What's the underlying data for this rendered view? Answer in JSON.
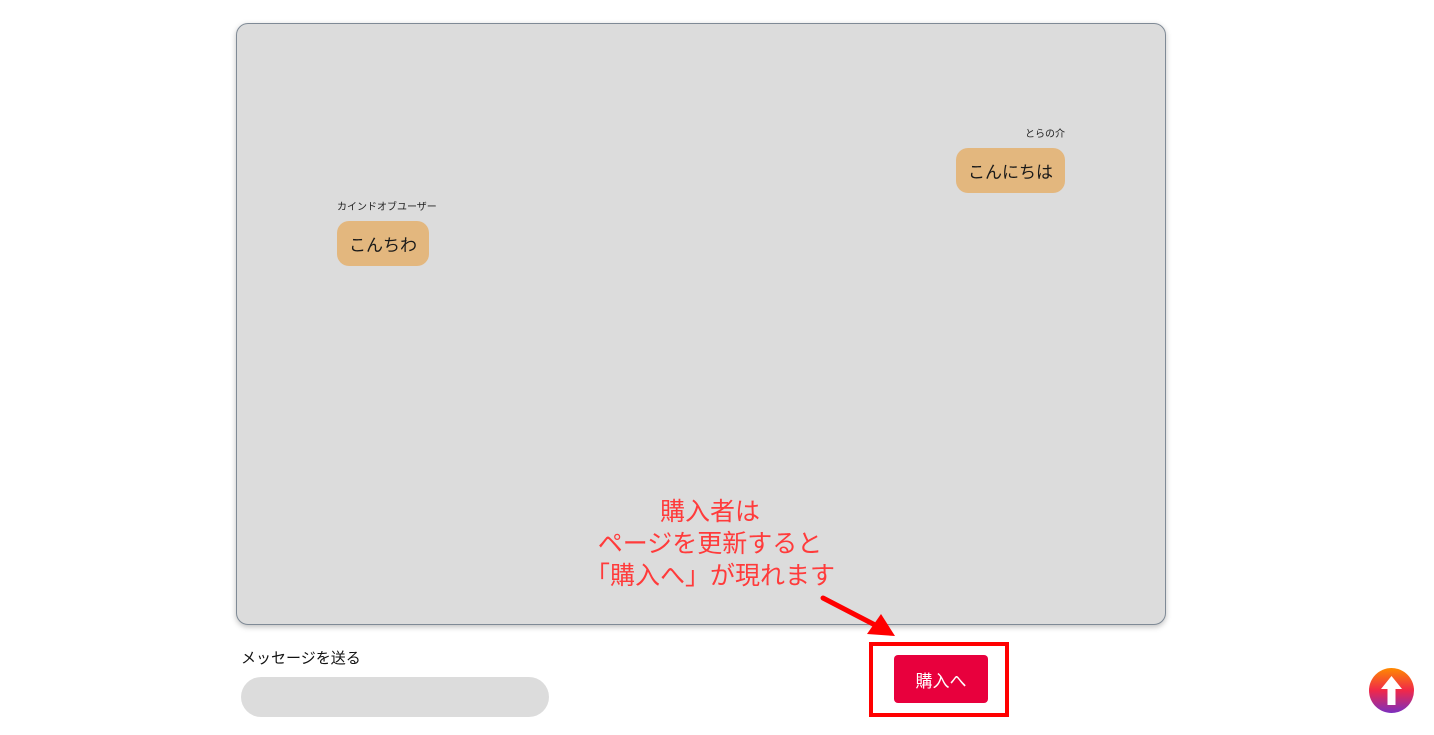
{
  "chat": {
    "messages": [
      {
        "sender": "カインドオブユーザー",
        "text": "こんちわ",
        "side": "left"
      },
      {
        "sender": "とらの介",
        "text": "こんにちは",
        "side": "right"
      }
    ]
  },
  "annotation": {
    "lines": [
      "購入者は",
      "ページを更新すると",
      "「購入へ」が現れます"
    ]
  },
  "form": {
    "send_label": "メッセージを送る",
    "input_value": "",
    "input_placeholder": ""
  },
  "buy_button": {
    "label": "購入へ"
  },
  "colors": {
    "chat_background": "#dcdcdc",
    "bubble": "#e3b77e",
    "annotation_red": "#ff3b3b",
    "buy_button": "#e8003d"
  },
  "icons": {
    "scroll_top": "arrow-up-icon"
  }
}
